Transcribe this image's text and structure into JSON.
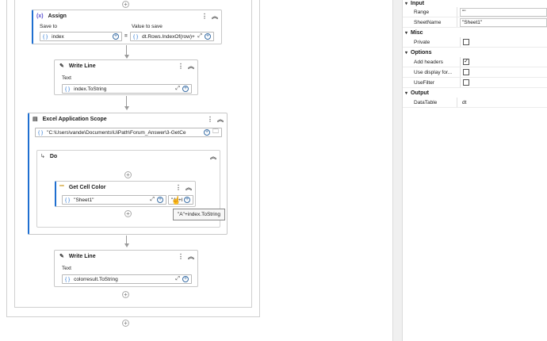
{
  "assign": {
    "title": "Assign",
    "icon": "(x)",
    "save_to_label": "Save to",
    "value_label": "Value to save",
    "save_to_value": "index",
    "equals": "=",
    "value_expression": "dt.Rows.IndexOf(row)+"
  },
  "write_line_1": {
    "title": "Write Line",
    "text_label": "Text",
    "text_value": "index.ToString"
  },
  "excel_scope": {
    "title": "Excel Application Scope",
    "path_value": "\"C:\\Users\\vande\\Documents\\UiPath\\Forum_Answer\\3-GetCe",
    "do_label": "Do",
    "get_cell_color": {
      "title": "Get Cell Color",
      "icon": "***",
      "sheet_value": "\"Sheet1\"",
      "cell_value": "\"A\"+I"
    }
  },
  "tooltip": {
    "text": "\"A\"+index.ToString"
  },
  "write_line_2": {
    "title": "Write Line",
    "text_label": "Text",
    "text_value": "colorresult.ToString"
  },
  "properties": {
    "categories": [
      {
        "name": "Input",
        "rows": [
          {
            "name": "Range",
            "value": "\"\""
          },
          {
            "name": "SheetName",
            "value": "\"Sheet1\""
          }
        ]
      },
      {
        "name": "Misc",
        "rows": [
          {
            "name": "Private",
            "checked": false
          }
        ]
      },
      {
        "name": "Options",
        "rows": [
          {
            "name": "Add headers",
            "checked": true
          },
          {
            "name": "Use display for...",
            "checked": false
          },
          {
            "name": "UseFilter",
            "checked": false
          }
        ]
      },
      {
        "name": "Output",
        "rows": [
          {
            "name": "DataTable",
            "value": "dt"
          }
        ]
      }
    ]
  }
}
